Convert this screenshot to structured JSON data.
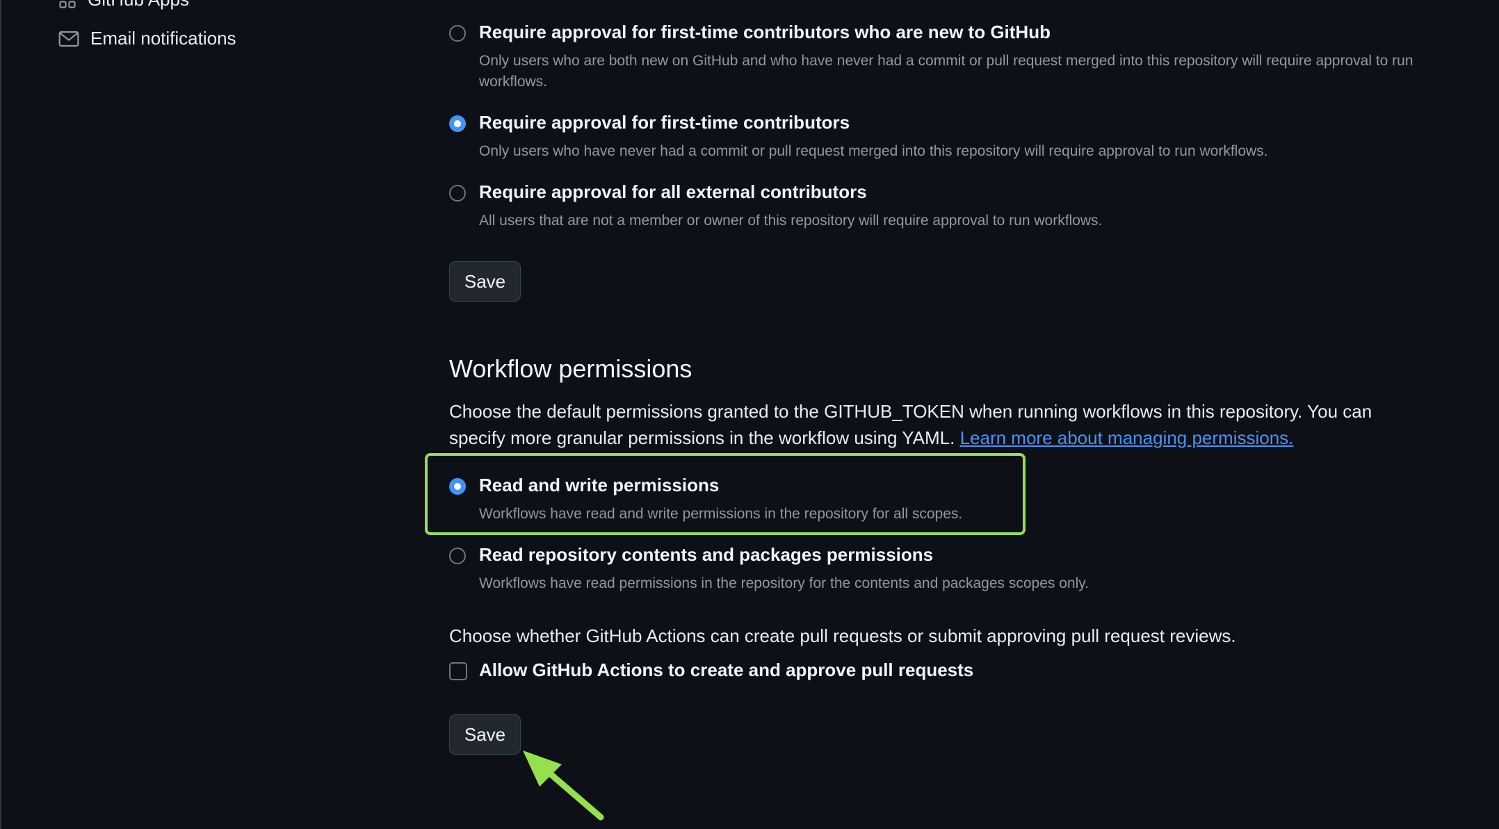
{
  "sidebar": {
    "items": [
      {
        "label": "GitHub Apps",
        "icon": "apps-icon"
      },
      {
        "label": "Email notifications",
        "icon": "mail-icon"
      }
    ]
  },
  "contributor_approval": {
    "options": [
      {
        "label": "Require approval for first-time contributors who are new to GitHub",
        "description": "Only users who are both new on GitHub and who have never had a commit or pull request merged into this repository will require approval to run workflows.",
        "selected": false
      },
      {
        "label": "Require approval for first-time contributors",
        "description": "Only users who have never had a commit or pull request merged into this repository will require approval to run workflows.",
        "selected": true
      },
      {
        "label": "Require approval for all external contributors",
        "description": "All users that are not a member or owner of this repository will require approval to run workflows.",
        "selected": false
      }
    ],
    "save_label": "Save"
  },
  "workflow_permissions": {
    "title": "Workflow permissions",
    "description": "Choose the default permissions granted to the GITHUB_TOKEN when running workflows in this repository. You can specify more granular permissions in the workflow using YAML.",
    "link_text": "Learn more about managing permissions.",
    "options": [
      {
        "label": "Read and write permissions",
        "description": "Workflows have read and write permissions in the repository for all scopes.",
        "selected": true
      },
      {
        "label": "Read repository contents and packages permissions",
        "description": "Workflows have read permissions in the repository for the contents and packages scopes only.",
        "selected": false
      }
    ],
    "pr_question": "Choose whether GitHub Actions can create pull requests or submit approving pull request reviews.",
    "pr_checkbox_label": "Allow GitHub Actions to create and approve pull requests",
    "pr_checkbox_checked": false,
    "save_label": "Save"
  },
  "colors": {
    "background": "#0d1117",
    "accent": "#4493f8",
    "highlight": "#95e04d"
  }
}
